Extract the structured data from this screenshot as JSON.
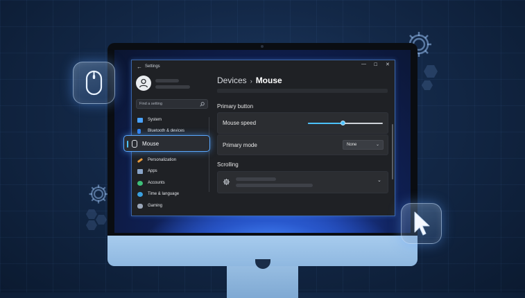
{
  "window": {
    "title": "Settings",
    "back_glyph": "←",
    "minimize_glyph": "—",
    "maximize_glyph": "☐",
    "close_glyph": "✕"
  },
  "search": {
    "placeholder": "Find a setting",
    "icon": "search-icon"
  },
  "sidebar": {
    "items": [
      {
        "label": "System",
        "icon": "monitor-icon",
        "color": "#4aa3ff"
      },
      {
        "label": "Bluetooth & devices",
        "icon": "bluetooth-icon",
        "color": "#2f80ed"
      },
      {
        "label": "Mouse",
        "icon": "mouse-icon",
        "selected": true
      },
      {
        "label": "Personalization",
        "icon": "brush-icon",
        "color": "#e89a3c"
      },
      {
        "label": "Apps",
        "icon": "apps-icon",
        "color": "#8aa4c8"
      },
      {
        "label": "Accounts",
        "icon": "accounts-icon",
        "color": "#3ec07a"
      },
      {
        "label": "Time & language",
        "icon": "globe-icon",
        "color": "#3aa0e0"
      },
      {
        "label": "Gaming",
        "icon": "controller-icon",
        "color": "#9aa6b8"
      }
    ]
  },
  "breadcrumb": {
    "parent": "Devices",
    "separator": "›",
    "current": "Mouse"
  },
  "sections": {
    "primary_button": "Primary button",
    "scrolling": "Scrolling"
  },
  "mouse_speed": {
    "label": "Mouse speed",
    "value": 0.47
  },
  "primary_mode": {
    "label": "Primary mode",
    "value": "None",
    "chevron": "⌄"
  },
  "scrolling_card": {
    "icon": "gear-icon",
    "chevron": "⌄"
  },
  "colors": {
    "accent": "#4cc2ff",
    "window_border": "#3b66a8"
  }
}
